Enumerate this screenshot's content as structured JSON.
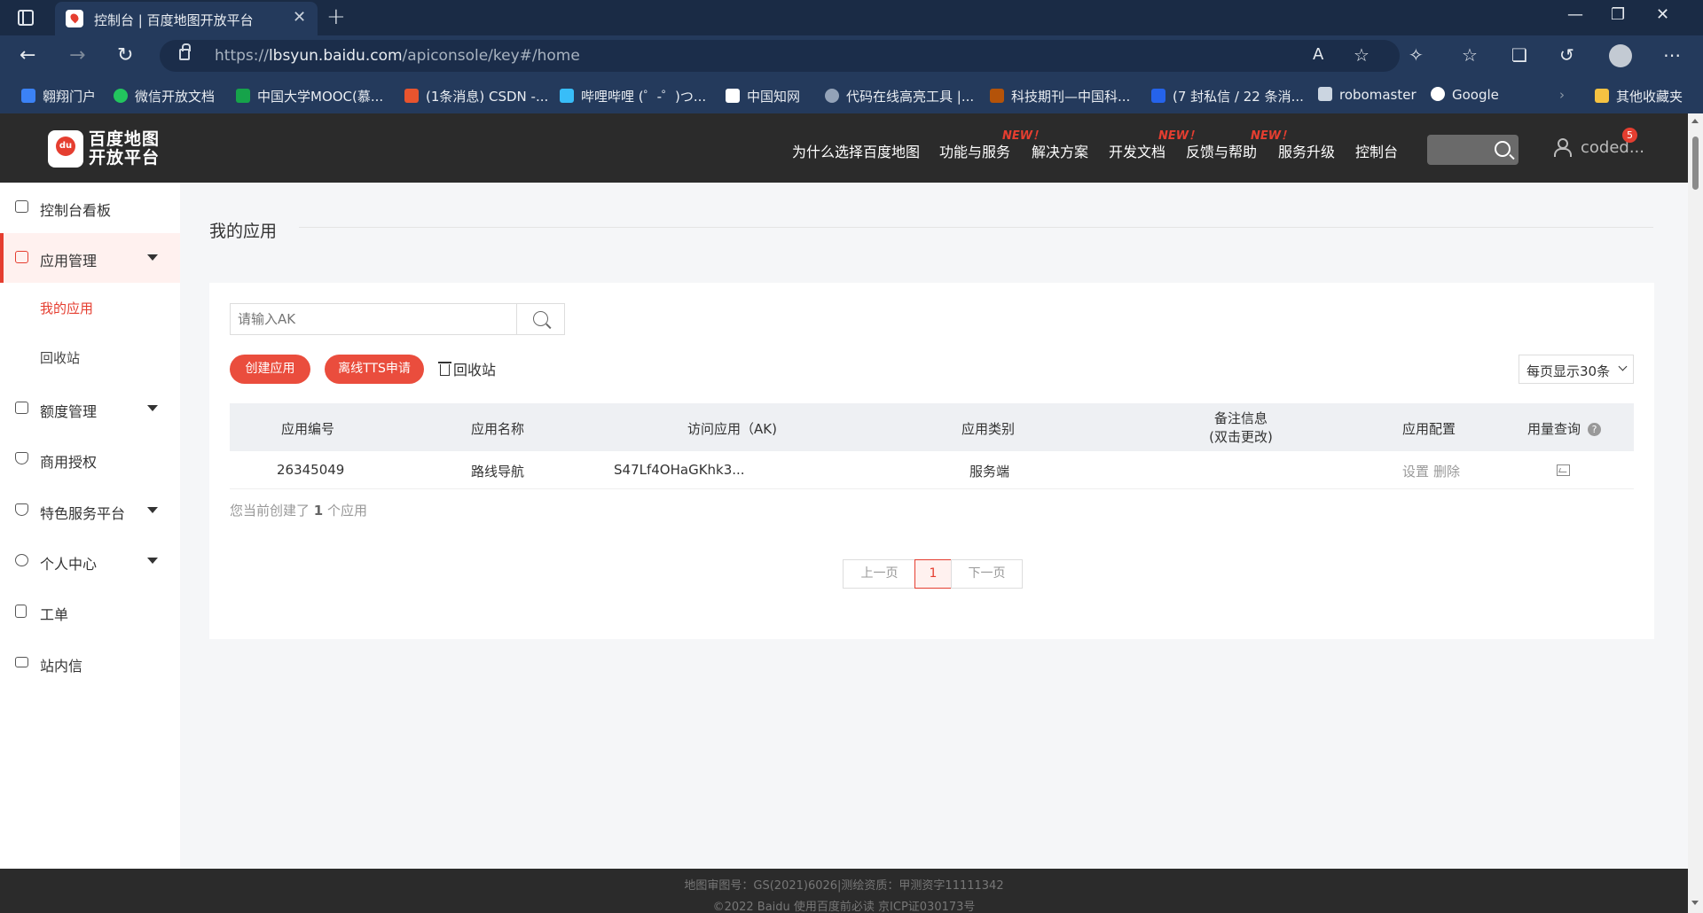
{
  "browser": {
    "tab_title": "控制台 | 百度地图开放平台",
    "url_prefix": "https://",
    "url_host": "lbsyun.baidu.com",
    "url_path": "/apiconsole/key#/home",
    "bookmarks": [
      {
        "label": "翱翔门户",
        "color": "#3b82f6"
      },
      {
        "label": "微信开放文档",
        "color": "#22c55e"
      },
      {
        "label": "中国大学MOOC(慕...",
        "color": "#16a34a"
      },
      {
        "label": "(1条消息) CSDN -...",
        "color": "#e8542e"
      },
      {
        "label": "哔哩哔哩 (゜-゜)つ...",
        "color": "#38bdf8"
      },
      {
        "label": "中国知网",
        "color": "#ffffff"
      },
      {
        "label": "代码在线高亮工具 |...",
        "color": "#94a3b8"
      },
      {
        "label": "科技期刊—中国科...",
        "color": "#b45309"
      },
      {
        "label": "(7 封私信 / 22 条消...",
        "color": "#2563eb"
      },
      {
        "label": "robomaster",
        "color": "#cbd5e1"
      },
      {
        "label": "Google",
        "color": "#ffffff"
      }
    ],
    "other_bookmarks": "其他收藏夹"
  },
  "site": {
    "logo_text": "百度地图开放平台",
    "nav": [
      {
        "label": "为什么选择百度地图",
        "new": false
      },
      {
        "label": "功能与服务",
        "new": true
      },
      {
        "label": "解决方案",
        "new": false
      },
      {
        "label": "开发文档",
        "new": false
      },
      {
        "label": "反馈与帮助",
        "new": true
      },
      {
        "label": "服务升级",
        "new": true
      },
      {
        "label": "控制台",
        "new": false
      }
    ],
    "new_badge": "NEW！",
    "username": "coded...",
    "message_count": "5"
  },
  "sidebar": {
    "items": [
      {
        "label": "控制台看板",
        "icon": "dashboard-icon"
      },
      {
        "label": "应用管理",
        "icon": "grid-icon"
      },
      {
        "label": "额度管理",
        "icon": "sliders-icon"
      },
      {
        "label": "商用授权",
        "icon": "shield-icon"
      },
      {
        "label": "特色服务平台",
        "icon": "tag-icon"
      },
      {
        "label": "个人中心",
        "icon": "user-icon"
      },
      {
        "label": "工单",
        "icon": "clipboard-icon"
      },
      {
        "label": "站内信",
        "icon": "mail-icon"
      }
    ],
    "sub_items": [
      "我的应用",
      "回收站"
    ]
  },
  "main": {
    "title": "我的应用",
    "search_placeholder": "请输入AK",
    "create_button": "创建应用",
    "tts_button": "离线TTS申请",
    "recycle_link": "回收站",
    "per_page": "每页显示30条",
    "columns": {
      "id": "应用编号",
      "name": "应用名称",
      "ak": "访问应用（AK)",
      "category": "应用类别",
      "remark_1": "备注信息",
      "remark_2": "(双击更改)",
      "config": "应用配置",
      "usage": "用量查询"
    },
    "rows": [
      {
        "id": "26345049",
        "name": "路线导航",
        "ak": "S47Lf4OHaGKhk3...",
        "category": "服务端",
        "remark": "",
        "config_set": "设置",
        "config_delete": "删除"
      }
    ],
    "count_prefix": "您当前创建了",
    "count_value": "1",
    "count_suffix": "个应用",
    "pager": {
      "prev": "上一页",
      "page": "1",
      "next": "下一页"
    }
  },
  "footer": {
    "line1": "地图审图号：GS(2021)6026|测绘资质：甲测资字11111342",
    "line2": "©2022 Baidu 使用百度前必读 京ICP证030173号"
  },
  "colors": {
    "accent": "#e53e30",
    "header_bg": "#2b2b2b",
    "browser_bg": "#243a5c"
  }
}
